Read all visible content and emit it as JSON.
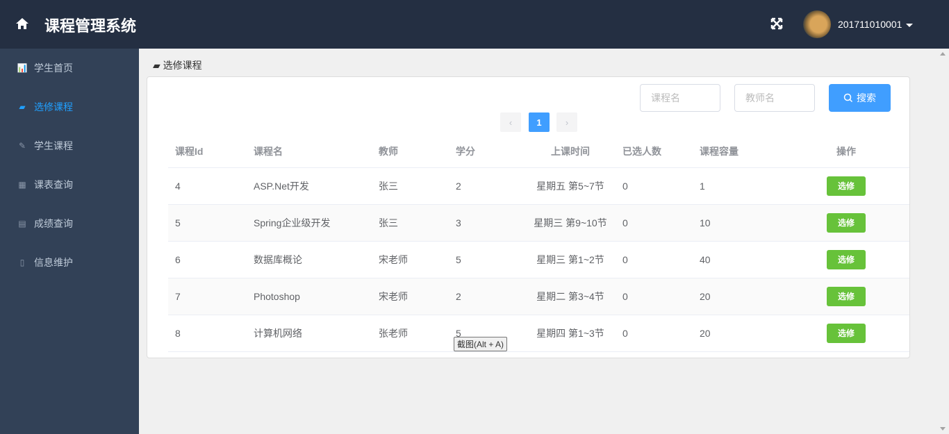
{
  "header": {
    "title": "课程管理系统",
    "username": "201711010001"
  },
  "sidebar": {
    "items": [
      {
        "label": "学生首页",
        "icon": "bar-chart-icon",
        "glyph": "📊"
      },
      {
        "label": "选修课程",
        "icon": "book-icon",
        "glyph": "▰",
        "active": true
      },
      {
        "label": "学生课程",
        "icon": "edit-icon",
        "glyph": "✎"
      },
      {
        "label": "课表查询",
        "icon": "table-icon",
        "glyph": "▦"
      },
      {
        "label": "成绩查询",
        "icon": "id-card-icon",
        "glyph": "▤"
      },
      {
        "label": "信息维护",
        "icon": "badge-icon",
        "glyph": "▯"
      }
    ]
  },
  "breadcrumb": "选修课程",
  "search": {
    "course_placeholder": "课程名",
    "teacher_placeholder": "教师名",
    "button": "搜索"
  },
  "pagination": {
    "current": "1",
    "prev": "‹",
    "next": "›"
  },
  "table": {
    "headers": [
      "课程Id",
      "课程名",
      "教师",
      "学分",
      "上课时间",
      "已选人数",
      "课程容量",
      "操作"
    ],
    "rows": [
      [
        "4",
        "ASP.Net开发",
        "张三",
        "2",
        "星期五 第5~7节",
        "0",
        "1"
      ],
      [
        "5",
        "Spring企业级开发",
        "张三",
        "3",
        "星期三 第9~10节",
        "0",
        "10"
      ],
      [
        "6",
        "数据库概论",
        "宋老师",
        "5",
        "星期三 第1~2节",
        "0",
        "40"
      ],
      [
        "7",
        "Photoshop",
        "宋老师",
        "2",
        "星期二 第3~4节",
        "0",
        "20"
      ],
      [
        "8",
        "计算机网络",
        "张老师",
        "5",
        "星期四 第1~3节",
        "0",
        "20"
      ]
    ],
    "action": "选修"
  },
  "tooltip": "截图(Alt + A)",
  "colors": {
    "header": "#242f42",
    "sidebar": "#324157",
    "accent": "#409eff",
    "success": "#67c23a"
  }
}
